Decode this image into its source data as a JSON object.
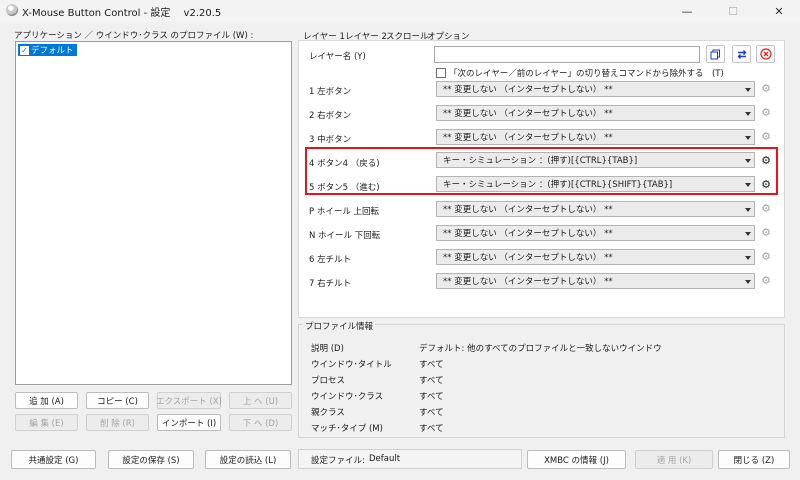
{
  "window": {
    "title": "X-Mouse Button Control - 設定　 v2.20.5",
    "minimize": "—",
    "maximize": "☐",
    "close": "✕"
  },
  "profiles": {
    "label": "アプリケーション ／ ウインドウ･クラス のプロファイル (W) :",
    "items": [
      {
        "label": "デフォルト",
        "checked": true
      }
    ],
    "buttons": {
      "add": "追 加 (A)",
      "copy": "コピー (C)",
      "export": "エクスポート (X)",
      "up": "上 へ (U)",
      "edit": "編 集 (E)",
      "delete": "削 除 (R)",
      "import": "インポート (I)",
      "down": "下 へ (D)"
    }
  },
  "tabs": [
    "レイヤー 1",
    "レイヤー 2",
    "スクロール",
    "オプション"
  ],
  "layer": {
    "name_label": "レイヤー名 (Y)",
    "name_value": "",
    "exclude_label": "「次のレイヤー／前のレイヤー」の切り替えコマンドから除外する　(T)",
    "exclude_checked": false,
    "icons": {
      "copy": "copy-icon",
      "swap": "swap-icon",
      "reset": "reset-icon"
    },
    "accent_colors": {
      "swap": "#1a3fc7",
      "reset": "#e02020",
      "highlight": "#e8141b"
    },
    "buttons": [
      {
        "label": "1  左ボタン",
        "action": "** 変更しない （インターセプトしない） **",
        "gear_active": false
      },
      {
        "label": "2  右ボタン",
        "action": "** 変更しない （インターセプトしない） **",
        "gear_active": false
      },
      {
        "label": "3  中ボタン",
        "action": "** 変更しない （インターセプトしない） **",
        "gear_active": false
      },
      {
        "label": "4  ボタン4 （戻る)",
        "action": "キー・シミュレーション ：(押す)[{CTRL}{TAB}]",
        "gear_active": true
      },
      {
        "label": "5  ボタン5 （進む)",
        "action": "キー・シミュレーション ：(押す)[{CTRL}{SHIFT}{TAB}]",
        "gear_active": true
      },
      {
        "label": "P  ホイール 上回転",
        "action": "** 変更しない （インターセプトしない） **",
        "gear_active": false
      },
      {
        "label": "N  ホイール 下回転",
        "action": "** 変更しない （インターセプトしない） **",
        "gear_active": false
      },
      {
        "label": "6  左チルト",
        "action": "** 変更しない （インターセプトしない） **",
        "gear_active": false
      },
      {
        "label": "7  右チルト",
        "action": "** 変更しない （インターセプトしない） **",
        "gear_active": false
      }
    ]
  },
  "profile_info": {
    "title": "プロファイル情報",
    "rows": [
      {
        "key": "説明 (D)",
        "value": "デフォルト: 他のすべてのプロファイルと一致しないウインドウ"
      },
      {
        "key": "ウインドウ･タイトル",
        "value": "すべて"
      },
      {
        "key": "プロセス",
        "value": "すべて"
      },
      {
        "key": "ウインドウ･クラス",
        "value": "すべて"
      },
      {
        "key": "親クラス",
        "value": "すべて"
      },
      {
        "key": "マッチ･タイプ (M)",
        "value": "すべて"
      }
    ]
  },
  "footer": {
    "common": "共通設定 (G)",
    "save": "設定の保存 (S)",
    "load": "設定の読込 (L)",
    "settings_file_label": "設定ファイル:",
    "settings_file_value": "Default",
    "about": "XMBC の情報 (J)",
    "apply": "適 用 (K)",
    "close": "閉じる (Z)"
  }
}
